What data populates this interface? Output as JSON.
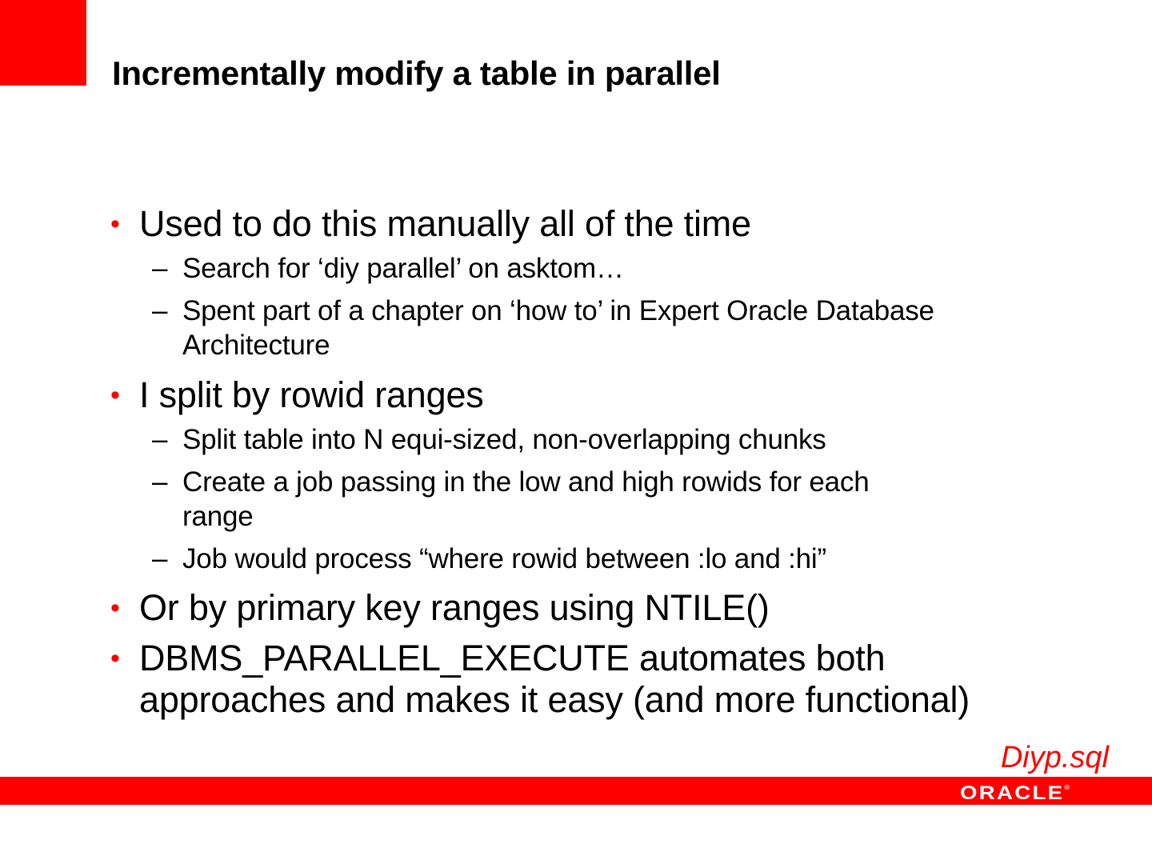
{
  "slide": {
    "title": "Incrementally modify a table in parallel",
    "bullets": [
      {
        "text": "Used to do this manually all of the time",
        "sub": [
          "Search for ‘diy parallel’ on asktom…",
          "Spent part of a chapter on ‘how to’ in Expert Oracle Database",
          "Architecture"
        ]
      },
      {
        "text": "I split by rowid ranges",
        "sub": [
          "Split table into N equi-sized, non-overlapping chunks",
          "Create a job passing in the low and high rowids for each",
          "range",
          "Job would process “where rowid between :lo and :hi”"
        ]
      },
      {
        "text": "Or by primary key ranges using NTILE()"
      },
      {
        "text": "DBMS_PARALLEL_EXECUTE automates both",
        "continuation": "approaches and makes it easy (and more functional)"
      }
    ],
    "bullet_glyph": "•",
    "dash_glyph": "–",
    "file_reference": "Diyp.sql"
  },
  "footer": {
    "logo_text": "ORACLE",
    "logo_mark": "®"
  },
  "colors": {
    "accent": "#ff0000",
    "text": "#000000",
    "background": "#ffffff"
  }
}
